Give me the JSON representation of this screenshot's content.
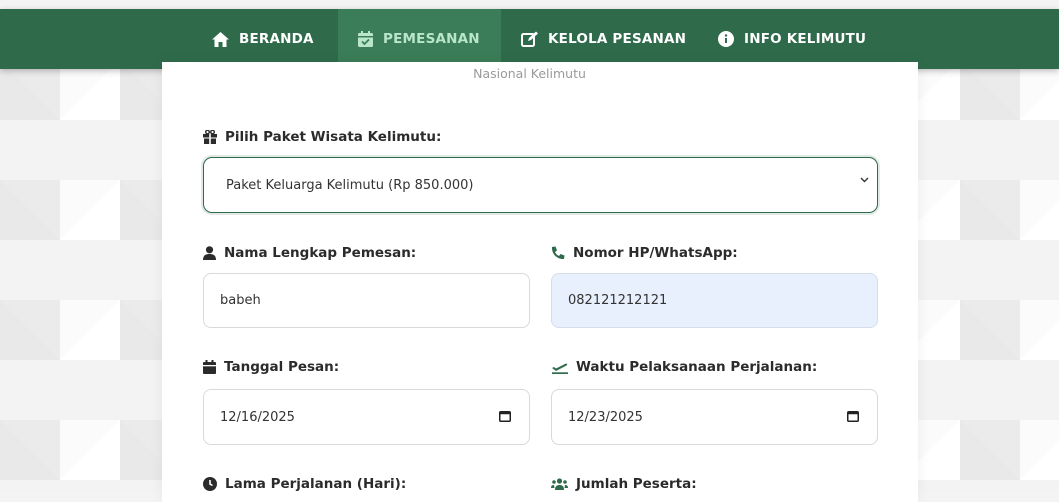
{
  "nav": {
    "items": [
      {
        "label": "BERANDA",
        "icon": "home-icon"
      },
      {
        "label": "PEMESANAN",
        "icon": "calendar-check-icon",
        "active": true
      },
      {
        "label": "KELOLA PESANAN",
        "icon": "edit-icon"
      },
      {
        "label": "INFO KELIMUTU",
        "icon": "info-icon"
      }
    ]
  },
  "header": {
    "subtitle": "Nasional Kelimutu"
  },
  "form": {
    "package": {
      "label": "Pilih Paket Wisata Kelimutu:",
      "selected": "Paket Keluarga Kelimutu (Rp 850.000)"
    },
    "name": {
      "label": "Nama Lengkap Pemesan:",
      "value": "babeh"
    },
    "phone": {
      "label": "Nomor HP/WhatsApp:",
      "value": "082121212121"
    },
    "order_date": {
      "label": "Tanggal Pesan:",
      "value": "12/16/2025"
    },
    "trip_date": {
      "label": "Waktu Pelaksanaan Perjalanan:",
      "value": "12/23/2025"
    },
    "duration": {
      "label": "Lama Perjalanan (Hari):"
    },
    "participants": {
      "label": "Jumlah Peserta:"
    }
  },
  "colors": {
    "primary": "#2f6b4b",
    "active_nav": "#3b7d58",
    "autofill": "#e8f0fe"
  }
}
